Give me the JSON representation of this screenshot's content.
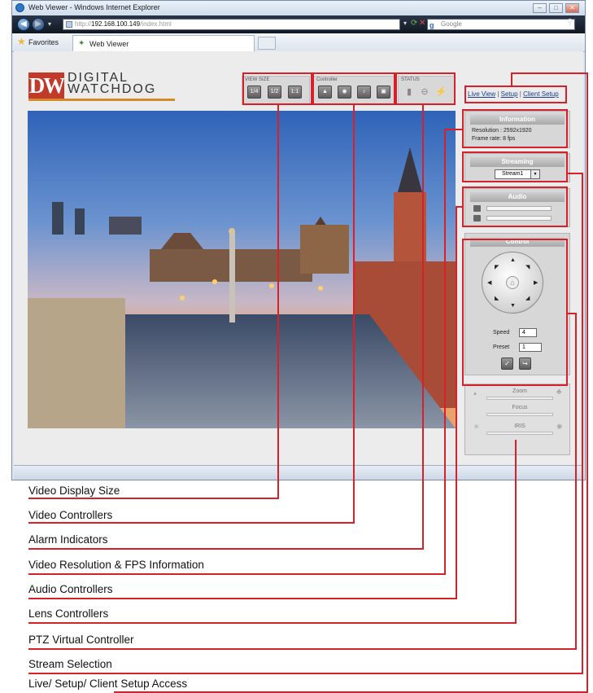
{
  "browser": {
    "title": "Web Viewer - Windows Internet Explorer",
    "url_prefix": "http://",
    "url_host": "192.168.100.149",
    "url_path": "/index.html",
    "search_placeholder": "Google",
    "favorites_label": "Favorites",
    "tab_label": "Web Viewer"
  },
  "logo": {
    "mark": "DW",
    "line1": "DIGITAL",
    "line2": "WATCHDOG"
  },
  "toolbar": {
    "view_size_label": "VIEW SIZE",
    "view_size_buttons": [
      "1/4",
      "1/2",
      "1:1"
    ],
    "controller_label": "Controller",
    "status_label": "STATUS"
  },
  "top_links": {
    "live_view": "Live View",
    "separator": "|",
    "setup": "Setup",
    "client_setup": "Client Setup"
  },
  "information": {
    "header": "Information",
    "resolution": "Resolution : 2592x1920",
    "frame_rate": "Frame rate: 8 fps"
  },
  "streaming": {
    "header": "Streaming",
    "selected": "Stream1"
  },
  "audio": {
    "header": "Audio"
  },
  "control": {
    "header": "Control",
    "speed_label": "Speed",
    "speed_value": "4",
    "preset_label": "Preset",
    "preset_value": "1"
  },
  "lens": {
    "zoom": "Zoom",
    "focus": "Focus",
    "iris": "IRIS"
  },
  "callouts": [
    "Video Display Size",
    "Video Controllers",
    "Alarm Indicators",
    "Video Resolution & FPS Information",
    "Audio Controllers",
    "Lens Controllers",
    "PTZ Virtual Controller",
    "Stream Selection",
    "Live/ Setup/ Client Setup Access"
  ],
  "colors": {
    "callout_red": "#d8202b",
    "brand_red": "#c23b2a",
    "link_blue": "#1a3c88"
  }
}
